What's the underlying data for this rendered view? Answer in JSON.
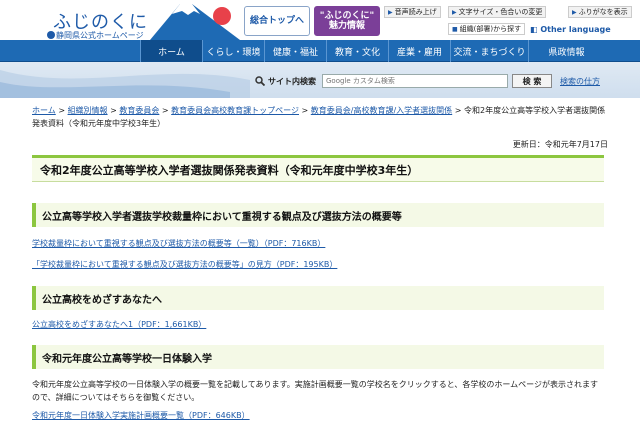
{
  "header": {
    "logo_main": "ふじのくに",
    "logo_sub": "静岡県公式ホームページ",
    "btn_home": "総合トップへ",
    "btn_miryoku": "\"ふじのくに\"\n魅力情報",
    "util": {
      "voice": "音声読み上げ",
      "textsize": "文字サイズ・色合いの変更",
      "furigana": "ふりがなを表示",
      "org": "組織(部署)から探す"
    },
    "other_lang": "Other language"
  },
  "nav": {
    "items": [
      "ホーム",
      "くらし・環境",
      "健康・福祉",
      "教育・文化",
      "産業・雇用",
      "交流・まちづくり",
      "県政情報"
    ]
  },
  "search": {
    "label": "サイト内検索",
    "placeholder": "Google カスタム検索",
    "button": "検 索",
    "help": "検索の仕方"
  },
  "breadcrumb": {
    "items": [
      "ホーム",
      "組織別情報",
      "教育委員会",
      "教育委員会高校教育課トップページ",
      "教育委員会/高校教育課/入学者選抜関係"
    ],
    "current": "令和2年度公立高等学校入学者選抜関係発表資料（令和元年度中学校3年生）"
  },
  "updated": "更新日：令和元年7月17日",
  "page_title": "令和2年度公立高等学校入学者選抜関係発表資料（令和元年度中学校3年生）",
  "sections": {
    "s1": {
      "heading": "公立高等学校入学者選抜学校裁量枠において重視する観点及び選抜方法の概要等",
      "link1": "学校裁量枠において重視する観点及び選抜方法の概要等（一覧）（PDF：716KB）",
      "link2": "「学校裁量枠において重視する観点及び選抜方法の概要等」の見方（PDF：195KB）"
    },
    "s2": {
      "heading": "公立高校をめざすあなたへ",
      "link1": "公立高校をめざすあなたへ1（PDF：1,661KB）"
    },
    "s3": {
      "heading": "令和元年度公立高等学校一日体験入学",
      "para": "令和元年度公立高等学校の一日体験入学の概要一覧を記載してあります。実施計画概要一覧の学校名をクリックすると、各学校のホームページが表示されますので、詳細についてはそちらを御覧ください。",
      "link1": "令和元年度一日体験入学実施計画概要一覧（PDF：646KB）"
    }
  },
  "colors": {
    "nav_blue": "#1e6ab4",
    "brand_purple": "#7b3f98",
    "accent_green": "#8cc63f",
    "link_blue": "#1e5aa8"
  }
}
